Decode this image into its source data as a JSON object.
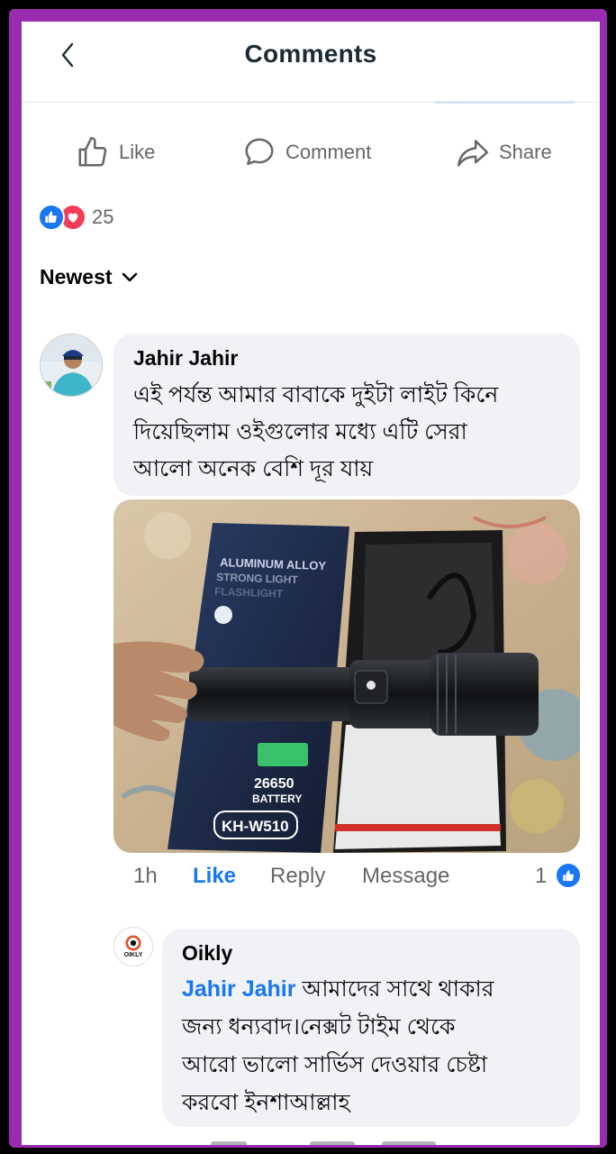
{
  "header": {
    "title": "Comments"
  },
  "actions": {
    "like": "Like",
    "comment": "Comment",
    "share": "Share"
  },
  "reactions": {
    "count": "25",
    "types": [
      "like",
      "love"
    ]
  },
  "sort": {
    "label": "Newest"
  },
  "comments": [
    {
      "author": "Jahir Jahir",
      "lines": [
        "এই পর্যন্ত আমার বাবাকে দুইটা লাইট কিনে",
        "দিয়েছিলাম ওইগুলোর মধ্যে এটি সেরা",
        "আলো অনেক বেশি দূর যায়"
      ],
      "photo_text": {
        "box_line1": "ALUMINUM ALLOY",
        "box_line2": "STRONG LIGHT",
        "box_line3": "FLASHLIGHT",
        "battery_line1": "26650",
        "battery_line2": "BATTERY",
        "model": "KH-W510"
      },
      "time": "1h",
      "like": "Like",
      "reply": "Reply",
      "message": "Message",
      "like_count": "1"
    }
  ],
  "reply": {
    "author": "Oikly",
    "avatar_text": "OIKLY",
    "mention": "Jahir Jahir",
    "line1_rest": " আমাদের  সাথে থাকার",
    "lines": [
      "জন্য ধন্যবাদ।নেক্সট টাইম থেকে",
      "আরো ভালো সার্ভিস দেওয়ার চেষ্টা",
      "করবো ইনশাআল্লাহ"
    ]
  },
  "colors": {
    "frame": "#9a2cb0",
    "link": "#1877f2",
    "bubble": "#f0f2f5"
  },
  "icons": [
    "back-icon",
    "like-icon",
    "comment-icon",
    "share-icon",
    "chevron-down-icon"
  ]
}
